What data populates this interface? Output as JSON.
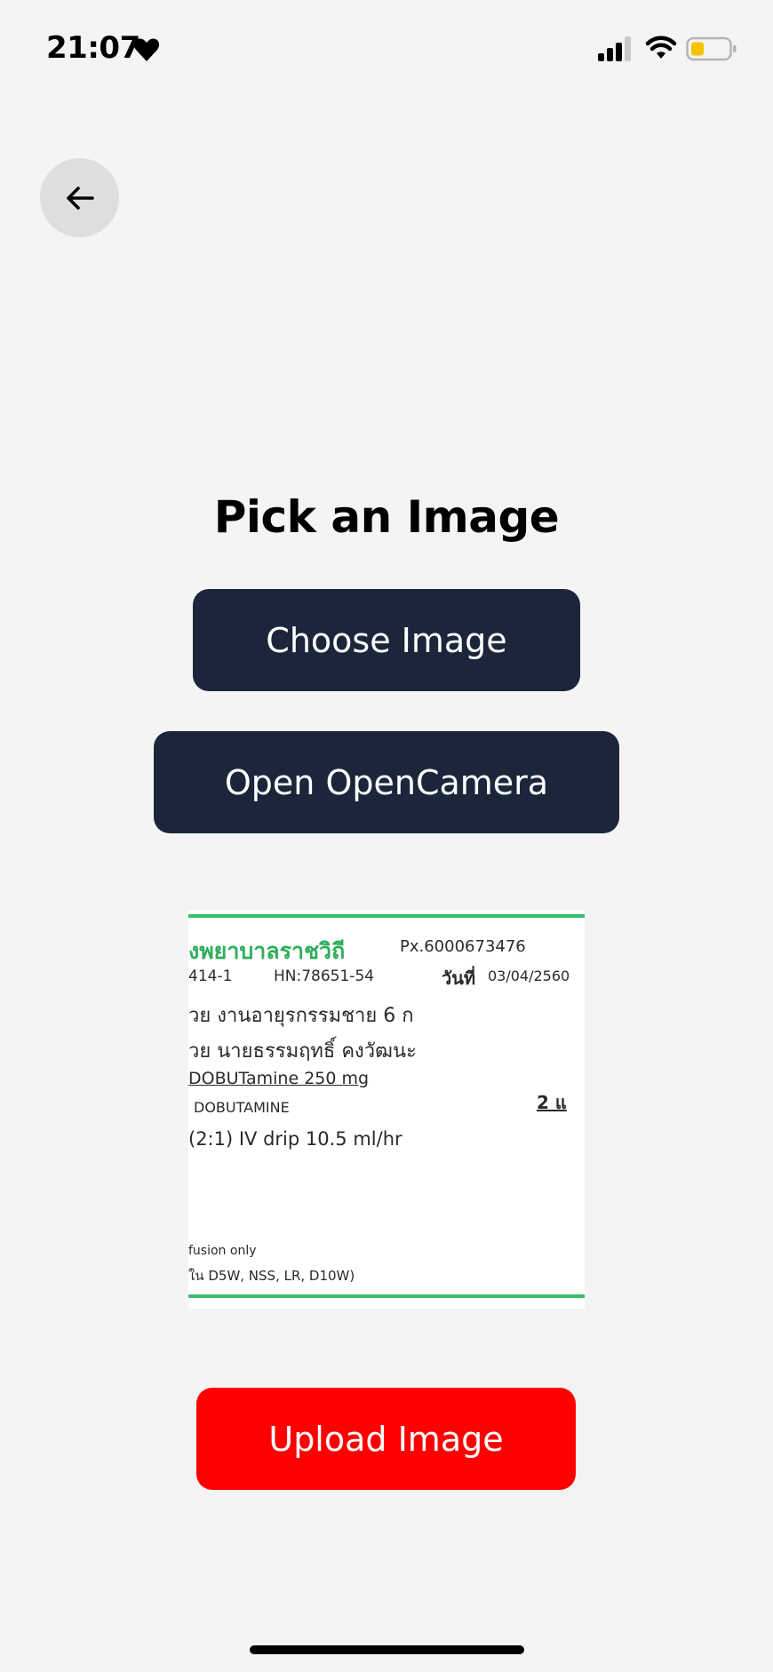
{
  "status_bar": {
    "time": "21:07",
    "icons": [
      "heart-icon",
      "signal-icon",
      "wifi-icon",
      "battery-icon"
    ],
    "battery_color": "#f5c400"
  },
  "header": {
    "back_icon": "arrow-left-icon"
  },
  "main": {
    "title": "Pick an Image",
    "choose_label": "Choose Image",
    "camera_label": "Open OpenCamera",
    "upload_label": "Upload Image"
  },
  "preview": {
    "hospital": "งพยาบาลราชวิถี",
    "px": "Px.6000673476",
    "code": "414-1",
    "hn": "HN:78651-54",
    "date_label": "วันที่",
    "date": "03/04/2560",
    "ward": "วย งานอายุรกรรมชาย 6 ก",
    "patient": "วย นายธรรมฤทธิ์ คงวัฒนะ",
    "drug": "DOBUTamine 250 mg",
    "drug_generic": "DOBUTAMINE",
    "qty": "2 แ",
    "dosage": "(2:1) IV drip 10.5 ml/hr",
    "note1": "fusion only",
    "note2": "ใน D5W, NSS, LR, D10W)"
  },
  "colors": {
    "background": "#f4f4f4",
    "primary_button": "#1b263b",
    "upload_button": "#ff0000",
    "back_button_bg": "#dedede",
    "accent_green": "#39c06a"
  }
}
